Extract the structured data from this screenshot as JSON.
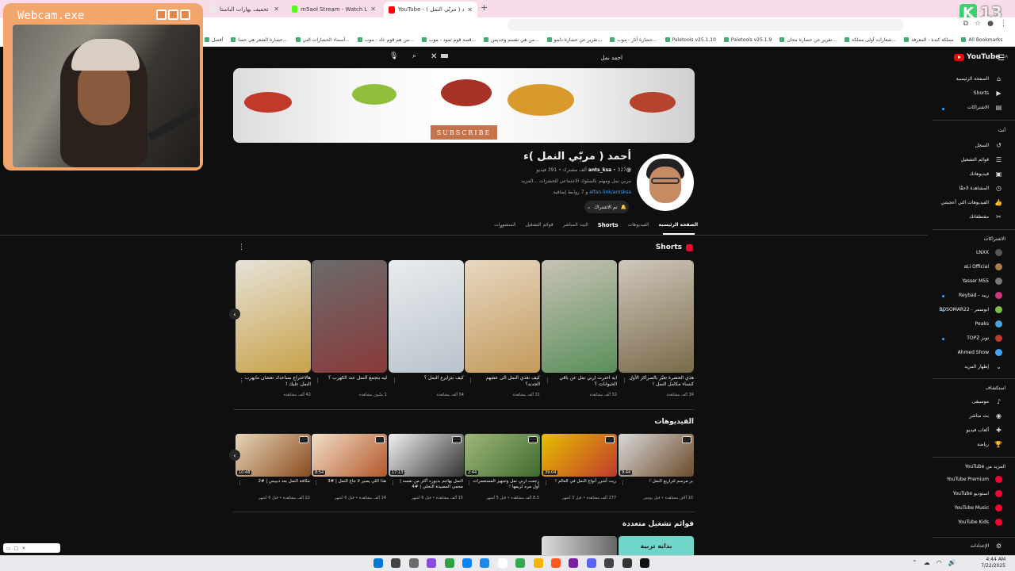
{
  "webcam": {
    "title": "Webcam.exe"
  },
  "browser": {
    "tabs": [
      {
        "label": "تخفيف بهارات الباستا",
        "active": false,
        "color": "#e9e9e9"
      },
      {
        "label": "m5aol Stream - Watch Live on",
        "active": false,
        "color": "#53fc18"
      },
      {
        "label": "YouTube - ( أحمد ( مربّي النمل",
        "active": true,
        "color": "#ff0000"
      }
    ],
    "bookmarks": [
      "أفضل",
      "حضارة الشعر هي حضا...",
      "أسماء الحضارات التي...",
      "من هم قوم عاد - موب...",
      "قصة قوم ثمود - موب...",
      "من هي تقسم وحديس...",
      "تقرير عن حضارة دلمو...",
      "حضارة آثار - موب...",
      "Paletools v25.1.10",
      "Paletools v25.1.9",
      "تقرير عن حضارة مجان...",
      "شعارات أولى مملكة...",
      "مملكة كندة - المعرفة",
      "All Bookmarks"
    ],
    "k_badge": "13"
  },
  "youtube": {
    "logo": "YouTube",
    "logo_sup": "SA",
    "search": {
      "value": "احمد نمل"
    },
    "banner": {
      "subscribe_label": "SUBSCRIBE"
    },
    "channel": {
      "name": "أحمد ( مربّي النمل )ء",
      "handle": "@ants_ksa",
      "subscribers": "327 ألف مشترك",
      "videos": "391 فيديو",
      "description": "مربي نمل ومهتم بالسلوك الاجتماعي للحشرات ...المزيد",
      "link": "alfan.link/antsksa",
      "more_links": "و 7 روابط إضافية",
      "subscribed_label": "تم الاشتراك"
    },
    "channel_tabs": [
      {
        "label": "الصفحة الرئيسية",
        "active": true
      },
      {
        "label": "الفيديوهات",
        "active": false
      },
      {
        "label": "Shorts",
        "active": false
      },
      {
        "label": "البث المباشر",
        "active": false
      },
      {
        "label": "قوائم التشغيل",
        "active": false
      },
      {
        "label": "المنشورات",
        "active": false
      }
    ],
    "shorts_section": {
      "title": "Shorts",
      "items": [
        {
          "title": "هذي الحشرة تعيّز بالصراكز الأول كنساء مكامل النمل !",
          "views": "34 ألف مشاهدة",
          "color1": "#cfc7bb",
          "color2": "#7a6a4a"
        },
        {
          "title": "ايه اخترت اربي نمل عن باقي الحيوانات ؟",
          "views": "32 ألف مشاهدة",
          "color1": "#c8c2b5",
          "color2": "#5a8f5a"
        },
        {
          "title": "كيف نغذي النمل الى عشهم الجديد؟",
          "views": "31 ألف مشاهدة",
          "color1": "#e7d7c2",
          "color2": "#c39a5b"
        },
        {
          "title": "كيف بتزايرع النمل ؟",
          "views": "54 ألف مشاهدة",
          "color1": "#e9ecef",
          "color2": "#b9c3cc"
        },
        {
          "title": "ليه بتجمع النمل عند الكهرب ؟",
          "views": "1 مليون مشاهدة",
          "color1": "#6b6b6b",
          "color2": "#8a3a3a"
        },
        {
          "title": "هالاختراع بساعدك تعشان مايهرب النمل عليك !",
          "views": "42 ألف مشاهدة",
          "color1": "#e6e2d8",
          "color2": "#c8a24a"
        }
      ]
    },
    "videos_section": {
      "title": "الفيديوهات",
      "items": [
        {
          "title": "بر مرسم لتزاريع النمل !",
          "meta": "10 آلاف مشاهدة • قبل يومين",
          "duration": "9:44",
          "color1": "#d9d9d9",
          "color2": "#6b4a2a"
        },
        {
          "title": "ريت أشرر أنواع النمل في العالم !",
          "meta": "277 ألف مشاهدة • قبل 3 أشهر",
          "duration": "39:04",
          "color1": "#e6c000",
          "color2": "#c0392b"
        },
        {
          "title": "رجعت اربي نمل وتجهيز المستعمرات أول مره لزيمها !",
          "meta": "8.5 ألف مشاهدة • قبل 5 أشهر",
          "duration": "2:44",
          "color1": "#9fb77a",
          "color2": "#3f6a2f"
        },
        {
          "title": "النمل يهاجم بدبوره أكثر من نفسه | محمي المصيدة النحلي | #4",
          "meta": "15 ألف مشاهدة • قبل 6 أشهر",
          "duration": "17:13",
          "color1": "#f2f2f2",
          "color2": "#333333"
        },
        {
          "title": "هذا اللي يصير لا جاع النمل | #3",
          "meta": "14 ألف مشاهدة • قبل 6 أشهر",
          "duration": "8:54",
          "color1": "#f0e0c8",
          "color2": "#b5562a"
        },
        {
          "title": "مكافة النمل بعد دبيبس | #2",
          "meta": "22 ألف مشاهدة • قبل 6 أشهر",
          "duration": "10:48",
          "color1": "#e7d6b8",
          "color2": "#8a4a1e"
        }
      ]
    },
    "playlists_section": {
      "title": "قوائم تشغيل متعددة",
      "overlay_text": "بداية تربية"
    },
    "sidebar": {
      "main": [
        {
          "label": "الصفحة الرئيسية",
          "icon": "home-icon",
          "glyph": "⌂"
        },
        {
          "label": "Shorts",
          "icon": "shorts-icon",
          "glyph": "▶"
        },
        {
          "label": "الاشتراكات",
          "icon": "subscriptions-icon",
          "glyph": "▤"
        }
      ],
      "you_header": "أنت",
      "you": [
        {
          "label": "السجل",
          "icon": "history-icon",
          "glyph": "↺"
        },
        {
          "label": "قوائم التشغيل",
          "icon": "playlists-icon",
          "glyph": "☰"
        },
        {
          "label": "فيديوهاتك",
          "icon": "your-videos-icon",
          "glyph": "▣"
        },
        {
          "label": "المشاهدة لاحقًا",
          "icon": "watch-later-icon",
          "glyph": "◷"
        },
        {
          "label": "الفيديوهات التي أعجبتني",
          "icon": "liked-icon",
          "glyph": "👍"
        },
        {
          "label": "مقتطفاتك",
          "icon": "clips-icon",
          "glyph": "✂"
        }
      ],
      "subs_header": "الاشتراكات",
      "subscriptions": [
        {
          "label": "LNXX",
          "color": "#555555"
        },
        {
          "label": "aLi Official",
          "color": "#b07a4a"
        },
        {
          "label": "Yasser M55",
          "color": "#777777"
        },
        {
          "label": "ريبد - Reybad",
          "color": "#d63384"
        },
        {
          "label": "ابوسمر - BOSOMAR22",
          "color": "#7bc043"
        },
        {
          "label": "Peaks",
          "color": "#4aa3df"
        },
        {
          "label": "توبز TOPZ",
          "color": "#c0392b"
        },
        {
          "label": "Ahmed Show",
          "color": "#3ea6ff"
        }
      ],
      "show_more": "إظهار المزيد",
      "explore_header": "استكشاف",
      "explore": [
        {
          "label": "موسيقى",
          "icon": "music-icon",
          "glyph": "♪"
        },
        {
          "label": "بث مباشر",
          "icon": "live-icon",
          "glyph": "◉"
        },
        {
          "label": "ألعاب فيديو",
          "icon": "gaming-icon",
          "glyph": "✚"
        },
        {
          "label": "رياضة",
          "icon": "sports-icon",
          "glyph": "🏆"
        }
      ],
      "more_header": "المزيد من YouTube",
      "more": [
        {
          "label": "YouTube Premium",
          "color": "#ff0033"
        },
        {
          "label": "استوديو YouTube",
          "color": "#ff0033"
        },
        {
          "label": "YouTube Music",
          "color": "#ff0033"
        },
        {
          "label": "YouTube Kids",
          "color": "#ff0033"
        }
      ],
      "settings": "الإعدادات"
    }
  },
  "taskbar": {
    "time": "4:44 AM",
    "date": "7/22/2025",
    "icons": [
      "#0078d4",
      "#444444",
      "#6b6b6b",
      "#8a4ae0",
      "#2ea043",
      "#0a84ff",
      "#1e88e5",
      "#ffffff",
      "#34a853",
      "#f4b400",
      "#ff5722",
      "#7b1fa2",
      "#5865f2",
      "#444444",
      "#333333",
      "#111111"
    ]
  }
}
